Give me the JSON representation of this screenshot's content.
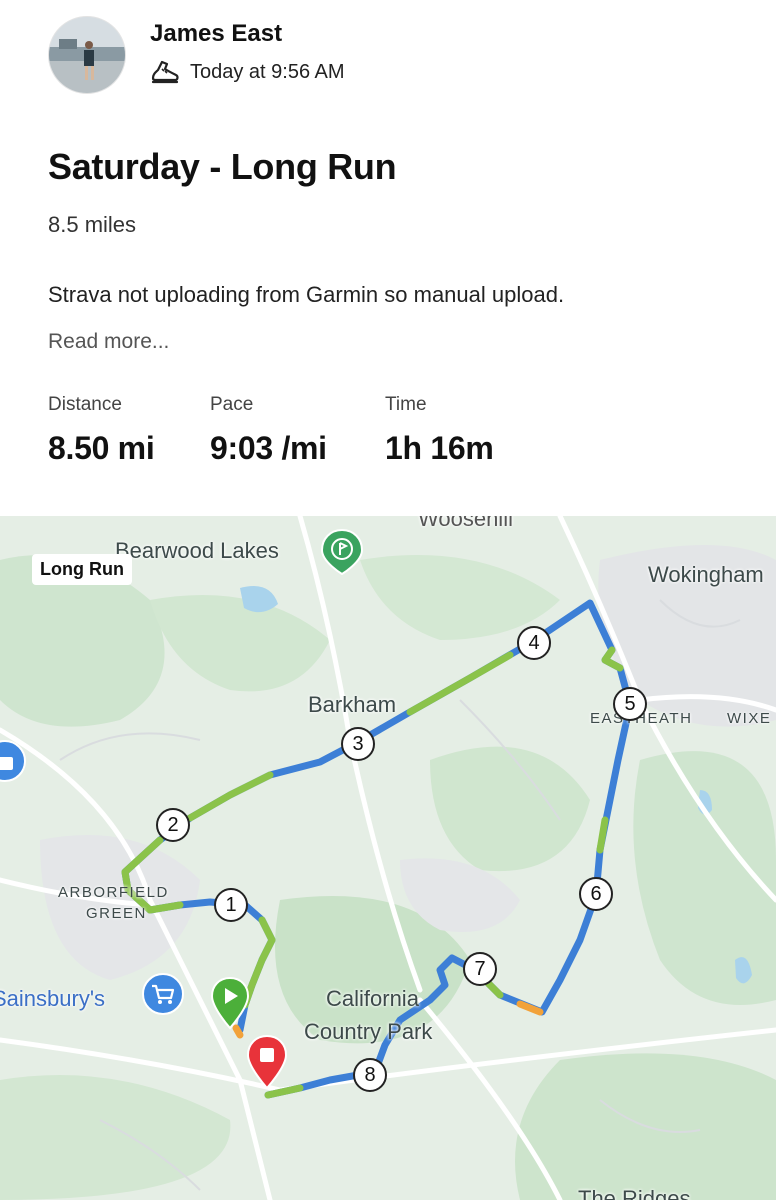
{
  "post": {
    "athlete_name": "James East",
    "timestamp": "Today at 9:56 AM",
    "activity_icon": "running-shoe-icon",
    "title": "Saturday - Long Run",
    "summary": "8.5 miles",
    "description": "Strava not uploading from Garmin so manual upload.",
    "read_more": "Read more..."
  },
  "stats": [
    {
      "label": "Distance",
      "value": "8.50 mi"
    },
    {
      "label": "Pace",
      "value": "9:03 /mi"
    },
    {
      "label": "Time",
      "value": "1h 16m"
    }
  ],
  "map": {
    "badge": "Long Run",
    "places": {
      "woosehill": "Woosehill",
      "bearwood": "Bearwood Lakes",
      "wokingham": "Wokingham",
      "barkham": "Barkham",
      "eastheath": "EASTHEATH",
      "wixe": "WIXE",
      "arborfield": "ARBORFIELD",
      "green": "GREEN",
      "sainsburys": "Sainsbury's",
      "california": "California",
      "country_park": "Country Park",
      "ridges": "The Ridges"
    },
    "mile_markers": [
      "1",
      "2",
      "3",
      "4",
      "5",
      "6",
      "7",
      "8"
    ],
    "route_colors": {
      "fast": "#3d7fd6",
      "medium": "#8bc34a",
      "slow": "#f2a23a"
    },
    "start_icon": "play-marker-icon",
    "finish_icon": "stop-marker-icon"
  }
}
